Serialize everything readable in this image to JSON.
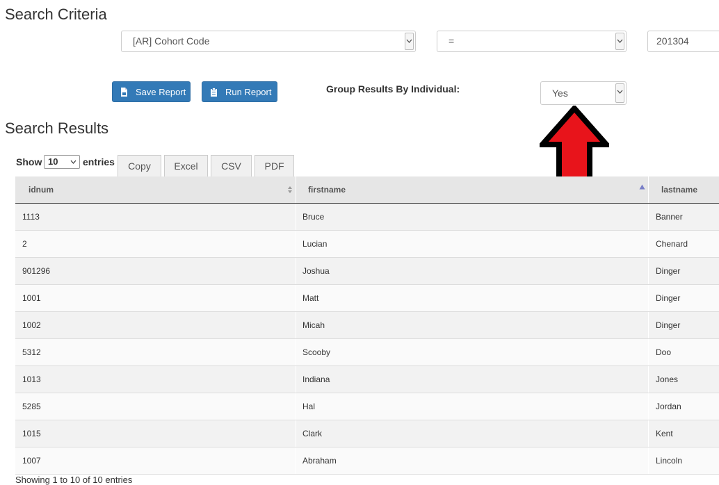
{
  "search_criteria": {
    "title": "Search Criteria",
    "field_select": "[AR] Cohort Code",
    "operator_select": "=",
    "value_input": "201304"
  },
  "actions": {
    "save_label": "Save Report",
    "run_label": "Run Report",
    "group_label": "Group Results By Individual:",
    "group_value": "Yes"
  },
  "results": {
    "title": "Search Results",
    "show_label": "Show",
    "entries_value": "10",
    "entries_label": "entries",
    "buttons": [
      "Copy",
      "Excel",
      "CSV",
      "PDF"
    ],
    "columns": [
      "idnum",
      "firstname",
      "lastname"
    ],
    "rows": [
      [
        "1113",
        "Bruce",
        "Banner"
      ],
      [
        "2",
        "Lucian",
        "Chenard"
      ],
      [
        "901296",
        "Joshua",
        "Dinger"
      ],
      [
        "1001",
        "Matt",
        "Dinger"
      ],
      [
        "1002",
        "Micah",
        "Dinger"
      ],
      [
        "5312",
        "Scooby",
        "Doo"
      ],
      [
        "1013",
        "Indiana",
        "Jones"
      ],
      [
        "5285",
        "Hal",
        "Jordan"
      ],
      [
        "1015",
        "Clark",
        "Kent"
      ],
      [
        "1007",
        "Abraham",
        "Lincoln"
      ]
    ],
    "footer": "Showing 1 to 10 of 10 entries"
  },
  "annotation": {
    "arrow_color": "#e8141b",
    "arrow_outline": "#000000"
  },
  "colors": {
    "primary": "#337ab7"
  }
}
